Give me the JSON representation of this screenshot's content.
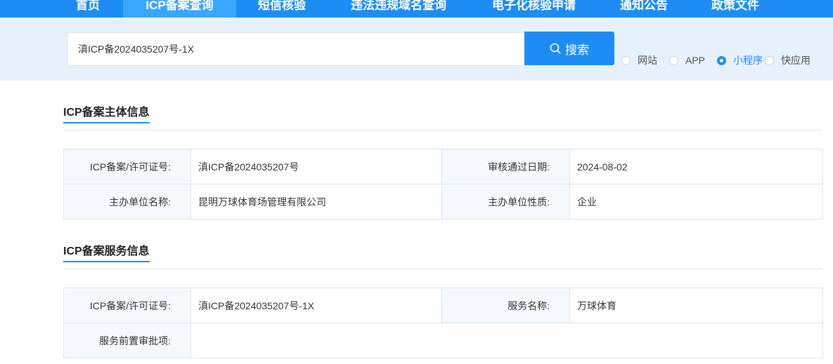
{
  "nav": {
    "items": [
      {
        "label": "首页"
      },
      {
        "label": "ICP备案查询"
      },
      {
        "label": "短信核验"
      },
      {
        "label": "违法违规域名查询"
      },
      {
        "label": "电子化核验申请"
      },
      {
        "label": "通知公告"
      },
      {
        "label": "政策文件"
      }
    ]
  },
  "search": {
    "value": "滇ICP备2024035207号-1X",
    "button_label": "搜索",
    "types": [
      {
        "label": "网站",
        "checked": false
      },
      {
        "label": "APP",
        "checked": false
      },
      {
        "label": "小程序",
        "checked": true
      },
      {
        "label": "快应用",
        "checked": false
      }
    ]
  },
  "colors": {
    "brand": "#1e8cf5",
    "band_bg": "#e6f1fc"
  },
  "subject_section": {
    "title": "ICP备案主体信息",
    "rows": [
      {
        "label1": "ICP备案/许可证号:",
        "value1": "滇ICP备2024035207号",
        "label2": "审核通过日期:",
        "value2": "2024-08-02"
      },
      {
        "label1": "主办单位名称:",
        "value1": "昆明万球体育场管理有限公司",
        "label2": "主办单位性质:",
        "value2": "企业"
      }
    ]
  },
  "service_section": {
    "title": "ICP备案服务信息",
    "rows": [
      {
        "label1": "ICP备案/许可证号:",
        "value1": "滇ICP备2024035207号-1X",
        "label2": "服务名称:",
        "value2": "万球体育"
      },
      {
        "label1": "服务前置审批项:",
        "value1": ""
      }
    ]
  }
}
